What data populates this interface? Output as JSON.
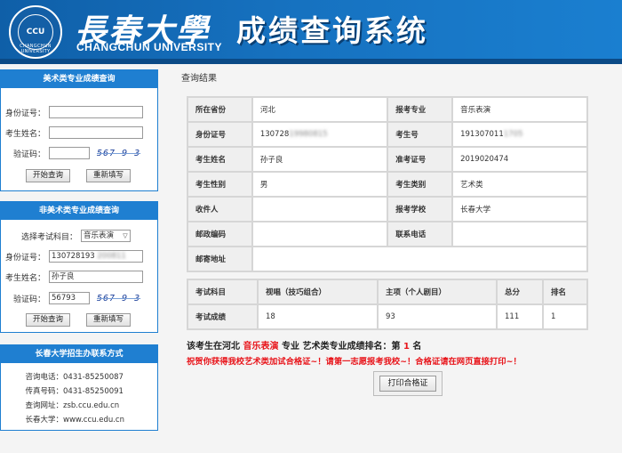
{
  "header": {
    "seal_text": "CCU",
    "seal_ring": "CHANGCHUN UNIVERSITY",
    "brand_cn": "長春大學",
    "brand_en": "CHANGCHUN UNIVERSITY",
    "system_title": "成绩查询系统",
    "colors": {
      "header_bg": "#1671bf",
      "panel_title_bg": "#1f7fd1"
    }
  },
  "art_panel": {
    "title": "美术类专业成绩查询",
    "id_label": "身份证号：",
    "id_value": "",
    "name_label": "考生姓名：",
    "name_value": "",
    "captcha_label": "验证码：",
    "captcha_value": "",
    "captcha_image": "567 9 3",
    "query_button": "开始查询",
    "reset_button": "重新填写"
  },
  "nonart_panel": {
    "title": "非美术类专业成绩查询",
    "subject_label": "选择考试科目：",
    "subject_selected": "音乐表演",
    "id_label": "身份证号：",
    "id_value": "130728193",
    "id_value_blurred": "200811",
    "name_label": "考生姓名：",
    "name_value": "孙子良",
    "captcha_label": "验证码：",
    "captcha_value": "56793",
    "captcha_image": "567 9 3",
    "query_button": "开始查询",
    "reset_button": "重新填写"
  },
  "contact_panel": {
    "title": "长春大学招生办联系方式",
    "items": [
      {
        "label": "咨询电话：",
        "value": "0431-85250087"
      },
      {
        "label": "传真号码：",
        "value": "0431-85250091"
      },
      {
        "label": "查询网址：",
        "value": "zsb.ccu.edu.cn"
      },
      {
        "label": "长春大学：",
        "value": "www.ccu.edu.cn"
      }
    ]
  },
  "results": {
    "label": "查询结果",
    "rows": [
      {
        "k1": "所在省份",
        "v1": "河北",
        "k2": "报考专业",
        "v2": "音乐表演"
      },
      {
        "k1": "身份证号",
        "v1": "130728",
        "v1_blur": "19980815",
        "k2": "考生号",
        "v2": "191307011",
        "v2_blur": "1705"
      },
      {
        "k1": "考生姓名",
        "v1": "孙子良",
        "k2": "准考证号",
        "v2": "2019020474"
      },
      {
        "k1": "考生性别",
        "v1": "男",
        "k2": "考生类别",
        "v2": "艺术类"
      },
      {
        "k1": "收件人",
        "v1": "",
        "k2": "报考学校",
        "v2": "长春大学"
      },
      {
        "k1": "邮政编码",
        "v1": "",
        "k2": "联系电话",
        "v2": ""
      },
      {
        "k1": "邮寄地址",
        "v1": ""
      }
    ],
    "score_headers": [
      "考试科目",
      "视唱（技巧组合）",
      "主项（个人剧目）",
      "总分",
      "排名"
    ],
    "score_values": [
      "考试成绩",
      "18",
      "93",
      "111",
      "1"
    ],
    "rank_prefix": "该考生在河北",
    "rank_major": "音乐表演",
    "rank_mid": "专业 艺术类专业成绩排名：第",
    "rank_number": "1",
    "rank_suffix": "名",
    "congrats": "祝贺你获得我校艺术类加试合格证~！请第一志愿报考我校~！合格证请在网页直接打印~！",
    "print_button": "打印合格证"
  }
}
